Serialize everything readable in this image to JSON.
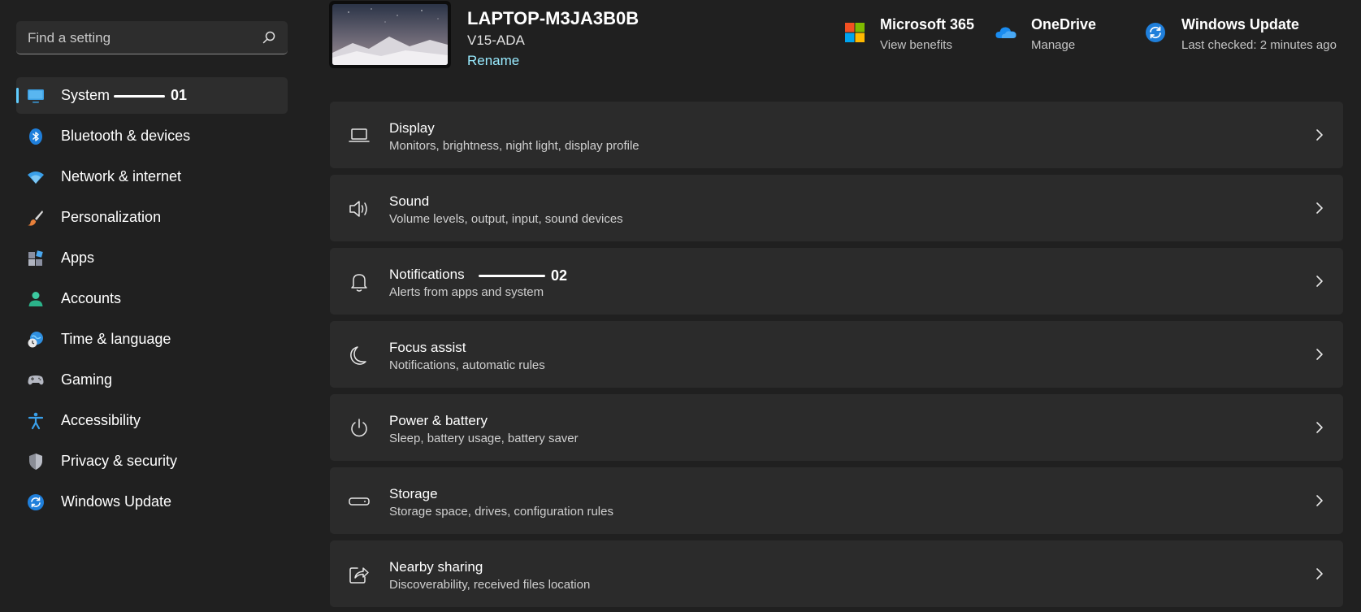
{
  "search": {
    "placeholder": "Find a setting",
    "icon": "search-icon"
  },
  "sidebar": {
    "items": [
      {
        "label": "System",
        "icon": "system-monitor-icon",
        "active": true
      },
      {
        "label": "Bluetooth & devices",
        "icon": "bluetooth-icon"
      },
      {
        "label": "Network & internet",
        "icon": "wifi-icon"
      },
      {
        "label": "Personalization",
        "icon": "paintbrush-icon"
      },
      {
        "label": "Apps",
        "icon": "apps-icon"
      },
      {
        "label": "Accounts",
        "icon": "person-icon"
      },
      {
        "label": "Time & language",
        "icon": "clock-globe-icon"
      },
      {
        "label": "Gaming",
        "icon": "gamepad-icon"
      },
      {
        "label": "Accessibility",
        "icon": "accessibility-icon"
      },
      {
        "label": "Privacy & security",
        "icon": "shield-icon"
      },
      {
        "label": "Windows Update",
        "icon": "update-icon"
      }
    ]
  },
  "callouts": {
    "first": "01",
    "second": "02"
  },
  "device": {
    "name": "LAPTOP-M3JA3B0B",
    "model": "V15-ADA",
    "rename": "Rename"
  },
  "topinfo": {
    "microsoft365": {
      "title": "Microsoft 365",
      "subtitle": "View benefits"
    },
    "onedrive": {
      "title": "OneDrive",
      "subtitle": "Manage"
    },
    "update": {
      "title": "Windows Update",
      "subtitle": "Last checked: 2 minutes ago"
    }
  },
  "cards": [
    {
      "title": "Display",
      "subtitle": "Monitors, brightness, night light, display profile",
      "icon": "laptop-display-icon"
    },
    {
      "title": "Sound",
      "subtitle": "Volume levels, output, input, sound devices",
      "icon": "speaker-icon"
    },
    {
      "title": "Notifications",
      "subtitle": "Alerts from apps and system",
      "icon": "bell-icon"
    },
    {
      "title": "Focus assist",
      "subtitle": "Notifications, automatic rules",
      "icon": "moon-icon"
    },
    {
      "title": "Power & battery",
      "subtitle": "Sleep, battery usage, battery saver",
      "icon": "power-icon"
    },
    {
      "title": "Storage",
      "subtitle": "Storage space, drives, configuration rules",
      "icon": "storage-drive-icon"
    },
    {
      "title": "Nearby sharing",
      "subtitle": "Discoverability, received files location",
      "icon": "share-icon"
    }
  ],
  "colors": {
    "accent": "#60cdff",
    "link": "#99ebff",
    "background": "#202020",
    "card": "#2b2b2b"
  }
}
